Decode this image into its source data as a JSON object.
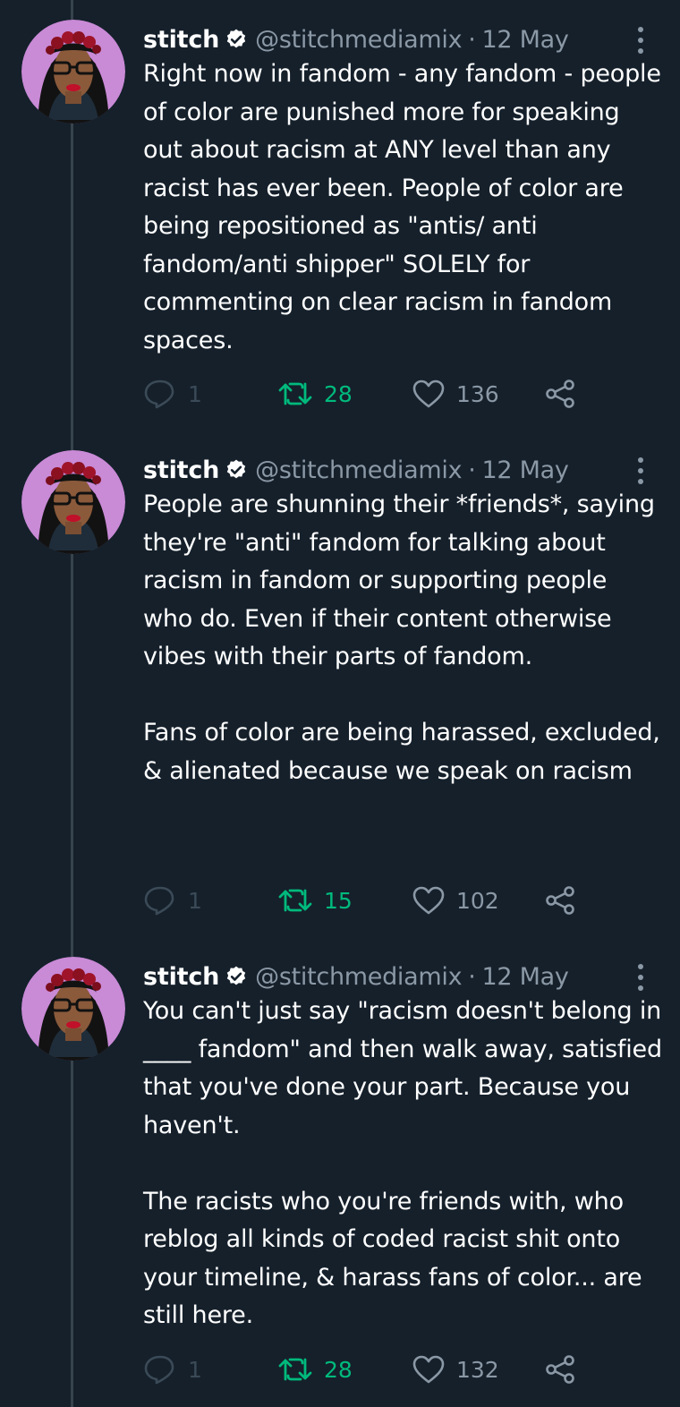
{
  "colors": {
    "background": "#15202b",
    "text_primary": "#ffffff",
    "text_secondary": "#8b98a5",
    "retweet_active": "#00ba7c",
    "thread_line": "#38444d"
  },
  "tweets": [
    {
      "name": "stitch",
      "handle": "@stitchmediamix",
      "separator": "·",
      "date": "12 May",
      "text": "Right now in fandom - any fandom - people of color are punished more for speaking out about racism at ANY level than any racist has ever been. People of color are being repositioned as \"antis/ anti fandom/anti shipper\" SOLELY for commenting on clear racism in fandom spaces.",
      "replies": "1",
      "retweets": "28",
      "likes": "136"
    },
    {
      "name": "stitch",
      "handle": "@stitchmediamix",
      "separator": "·",
      "date": "12 May",
      "text": "People are shunning their *friends*, saying they're \"anti\" fandom for talking about racism in fandom or supporting people who do. Even if their content otherwise vibes with their parts of fandom.\n\nFans of color are being harassed, excluded, & alienated because we speak on racism",
      "replies": "1",
      "retweets": "15",
      "likes": "102"
    },
    {
      "name": "stitch",
      "handle": "@stitchmediamix",
      "separator": "·",
      "date": "12 May",
      "text": "You can't just say \"racism doesn't belong in ____ fandom\" and then walk away, satisfied that you've done your part. Because you haven't.\n\nThe racists who you're friends with, who reblog all kinds of coded racist shit onto your timeline, & harass fans of color... are still here.",
      "replies": "1",
      "retweets": "28",
      "likes": "132"
    }
  ]
}
